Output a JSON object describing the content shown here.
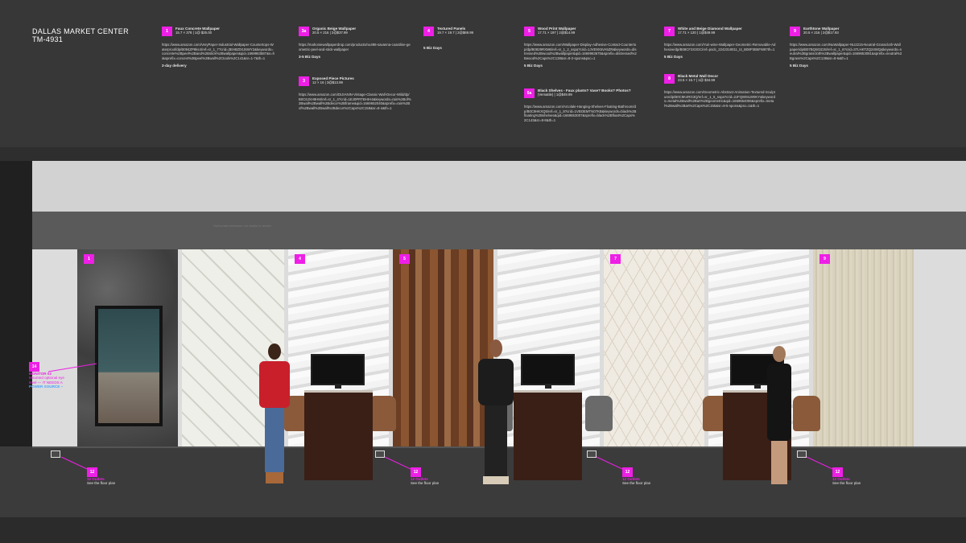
{
  "title": {
    "line1": "DALLAS MARKET CENTER",
    "line2": "TM-4931"
  },
  "accent": "#ee1fe6",
  "products": [
    {
      "num": "1",
      "name": "Faux Concrete Wallpaper",
      "price": "15.7 × 378 | 1@ $25.00",
      "url": "https://www.amazon.com/VeryPaper-Industrial-Wallpaper-Countertops-Waterproof/dp/B094ZP8ks4/ref=sr_1_7?crid=3EH8Z0XJ6WY2&keywords=concrete%2Bpeel%2Band%2Bstick%2Bwallpaper&qid=1669963587&s=hi&sprefix=concret%2Bpeel%2Bwall%2Ctools%2C141&sr=1-7&th=1",
      "extra": "2-day delivery"
    },
    {
      "num": "3a",
      "name": "Organic Beige Wallpaper",
      "price": "20.5 × 216 | 2@$37.99",
      "url": "https://mahoniewallpaperdrop.com/products/nu495-savanna-coastline-geometric-peel-and-stick-wallpaper",
      "extra": "3-5 Biz Days"
    },
    {
      "num": "3",
      "name": "Exposed Piece Pictures",
      "price": "12 × 16 | 3@$13.99",
      "url": "https://www.amazon.com/DIJIANIN-Vintage-Classic-Wall-Decor-Wild/dp/B0C6JXH9HM/ref=sr_1_4?crid=1EJ0PRTBHIH4&keywords=rain%2Bof%2Bwall%2Bwall%2Bdecor%2Bframe&qid=1669652040&sprefix=rain%2Bof%2Bwall%2Bwall%2Bdecor%2Caps%2C158&sr=8-4&th=1"
    },
    {
      "num": "4",
      "name": "Textured Panels",
      "price": "19.7 × 19.7 | 2@$69.99",
      "url": "",
      "extra": "5 Biz Days"
    },
    {
      "num": "5",
      "name": "Wood Print Wallpaper",
      "price": "17.71 × 197 | 2@$14.99",
      "url": "https://www.amazon.com/Wallpaper-Display-Adhesive-Contact-Countertop/dp/B0829RXM6/ref=sr_1_2_sspa?crid=1JVE9X5VA5ZR&keywords=distressed%2Bwood%2Bwallpaper&qid=1669963675&sprefix=distressed%2Bwood%2Caps%2C138&sr=8-2-spons&psc=1",
      "extra": "5 Biz Days"
    },
    {
      "num": "6a",
      "name": "Black Shelves - Faux plants? Vase? Books? Photos?",
      "price": "(Versatile) | 1@$49.99",
      "url": "https://www.amazon.com/Arcolale-Hanging-Shelves-Floating-Bathroom/dp/B0C9HKXQ5/ref=sr_1_8?crid=1VBOEMTN07KB&keywords=black%2Bfloating%2Bshelves&qid=1669653007&sprefix=black%2Bfloat%2Caps%2C143&sr=8-8&th=1"
    },
    {
      "num": "7",
      "name": "White and Beige Diamond Wallpaper",
      "price": "17.71 × 120 | 1@$49.99",
      "url": "https://www.amazon.com/Yuri-wine-Wallpaper-Geometric-Removable-Adhesive/dp/B08CF3X3GC/ref=psdc_2242318011_t4_B08P3B5FW8?th=1",
      "extra": "5 Biz Days"
    },
    {
      "num": "8",
      "name": "Black Metal Wall Decor",
      "price": "23.5 × 15.7 | 1@ $34.99",
      "url": "https://www.amazon.com/Geometric-Abstract-Animation-Textured-Sculpture/dp/B0C9K4RG3Q/ref=sr_1_5_sspa?crid=2JFQ80SLW0KY&keywords=metal%2Bwall%2Bart%2Bgeometric&qid=1669654006&sprefix=metal%2Bwall%2Bart%2Caps%2C155&sr=8-5-spons&psc=1&th=1"
    },
    {
      "num": "9",
      "name": "Earthtone Wallpaper",
      "price": "20.5 × 216 | 2@$17.93",
      "url": "https://www.amazon.com/NuWallpaper-NU2215-Neutral-Grasscloth-Wallpaper/dp/B07BQW3ZJ8/ref=sr_1_6?crid=37LHKTZQ24WQ&keywords=neutral%2Bgrasscloth%2Bwallpaper&qid=1669653081&sprefix=neutral%2Bgrass%2Caps%2C138&sr=8-6&th=1",
      "extra": "5 Biz Days"
    }
  ],
  "wall_panels": [
    "1",
    "4",
    "5",
    "7",
    "9"
  ],
  "faint_text": "Horizontal extension not visible in render",
  "monitor_callout": {
    "num": "14",
    "line1": "MONITOR 02",
    "line2": "Mounted optional eye",
    "line3": "level — IT NEEDS A",
    "line4": "POWER SOURCE ~"
  },
  "outlet_callouts": [
    {
      "num": "12",
      "label": "12 Outlets",
      "sub": "See the floor plan"
    },
    {
      "num": "12",
      "label": "12 Outlets",
      "sub": "See the floor plan"
    },
    {
      "num": "12",
      "label": "12 Outlets",
      "sub": "See the floor plan"
    },
    {
      "num": "12",
      "label": "12 Outlets",
      "sub": "See the floor plan"
    }
  ]
}
